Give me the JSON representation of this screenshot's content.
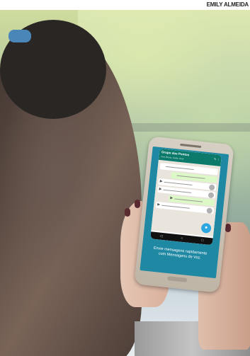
{
  "photo_credit": "EMILY ALMEIDA",
  "scene": {
    "phone": {
      "chat_title": "Grupo dos Pontos",
      "chat_subtitle": "Ana, Bruno, Carla, Você",
      "navbar_icons": [
        "back-icon",
        "home-icon",
        "recent-apps-icon"
      ],
      "mic_icon": "microphone-icon",
      "promo_line1": "Envie mensagens rapidamente",
      "promo_line2": "com Mensagens de Voz."
    }
  }
}
